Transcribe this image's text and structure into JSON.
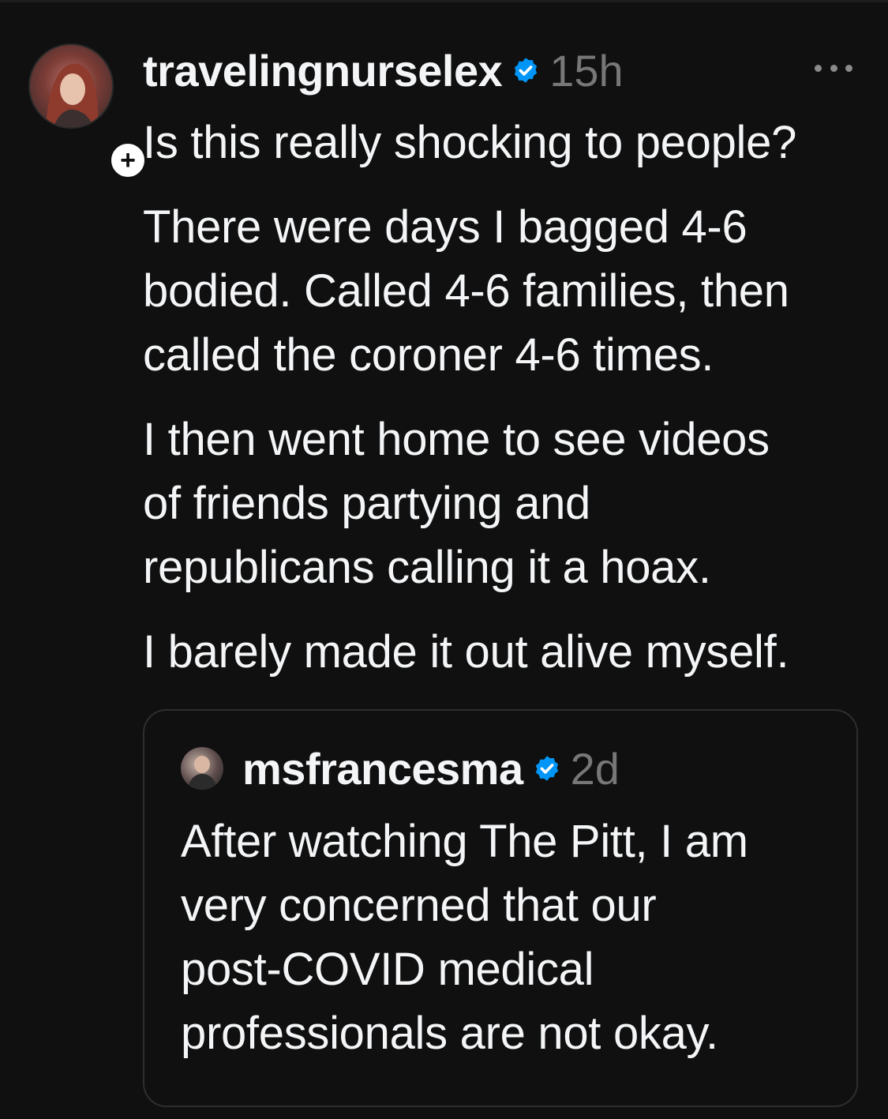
{
  "post": {
    "username": "travelingnurselex",
    "time": "15h",
    "follow_symbol": "+",
    "paragraphs": [
      "Is this really shocking to people?",
      "There were days I bagged 4-6\nbodied. Called 4-6 families, then\ncalled the coroner 4-6 times.",
      "I then went home to see videos\nof friends partying and\nrepublicans calling it a hoax.",
      "I barely made it out alive myself."
    ]
  },
  "quoted_post": {
    "username": "msfrancesma",
    "time": "2d",
    "text": "After watching The Pitt, I am\nvery concerned that our\npost-COVID medical\nprofessionals are not okay."
  },
  "colors": {
    "background": "#101010",
    "text": "#f3f5f7",
    "muted": "#777777",
    "verified": "#0095f6"
  }
}
